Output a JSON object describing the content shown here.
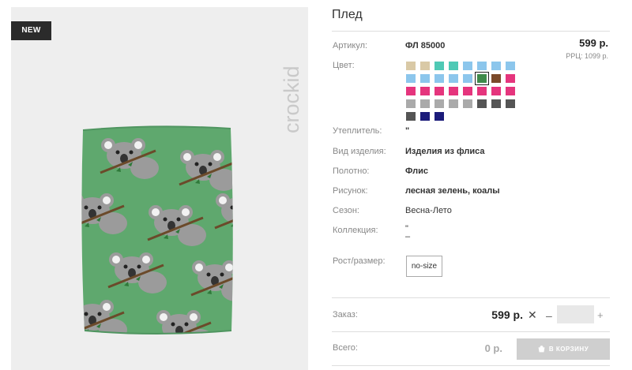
{
  "badge": "NEW",
  "brand": "crockid",
  "product": {
    "title": "Плед",
    "price": "599 р.",
    "rrp": "РРЦ: 1099 р."
  },
  "details": {
    "article_label": "Артикул:",
    "article_value": "ФЛ 85000",
    "color_label": "Цвет:",
    "insulation_label": "Утеплитель:",
    "insulation_value": "\"",
    "type_label": "Вид изделия:",
    "type_value": "Изделия из флиса",
    "fabric_label": "Полотно:",
    "fabric_value": "Флис",
    "pattern_label": "Рисунок:",
    "pattern_value": "лесная зелень, коалы",
    "season_label": "Сезон:",
    "season_value": "Весна-Лето",
    "collection_label": "Коллекция:",
    "collection_value_1": "\"",
    "collection_value_2": "–",
    "size_label": "Рост/размер:",
    "size_value": "no-size"
  },
  "colors": [
    "#d9c9a6",
    "#d9c9a6",
    "#4fc9b5",
    "#4fc9b5",
    "#8cc6ec",
    "#8cc6ec",
    "#8cc6ec",
    "#8cc6ec",
    "#8cc6ec",
    "#8cc6ec",
    "#8cc6ec",
    "#8cc6ec",
    "#8cc6ec",
    "#3e8a4a",
    "#7b4a2a",
    "#e5357d",
    "#e5357d",
    "#e5357d",
    "#e5357d",
    "#e5357d",
    "#e5357d",
    "#e5357d",
    "#e5357d",
    "#e5357d",
    "#aaaaaa",
    "#aaaaaa",
    "#aaaaaa",
    "#aaaaaa",
    "#aaaaaa",
    "#555555",
    "#555555",
    "#555555",
    "#555555",
    "#1b1b7a",
    "#1b1b7a"
  ],
  "selected_color_index": 13,
  "order": {
    "label": "Заказ:",
    "price": "599 р.",
    "times": "✕",
    "minus": "–",
    "quantity": "",
    "plus": "+"
  },
  "total": {
    "label": "Всего:",
    "value": "0 р.",
    "cart_button": "В КОРЗИНУ"
  }
}
